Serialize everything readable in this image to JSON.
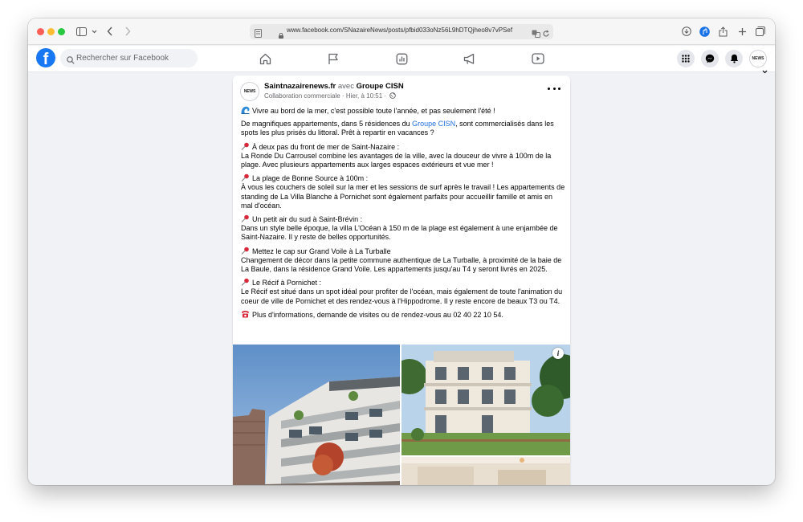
{
  "browser": {
    "url": "www.facebook.com/SNazaireNews/posts/pfbid033oNz56L9hDTQjheo8v7vPSef"
  },
  "facebook": {
    "logo_letter": "f",
    "search_placeholder": "Rechercher sur Facebook",
    "nav": [
      "home-icon",
      "flag-icon",
      "gaming-icon",
      "megaphone-icon",
      "video-icon"
    ],
    "brand_color": "#1877f2"
  },
  "post": {
    "avatar_text": "NEWS",
    "author": "Saintnazairenews.fr",
    "with_word": "avec",
    "partner": "Groupe CISN",
    "subtitle": "Collaboration commerciale · Hier, à 10:51 ·",
    "intro": "Vivre au bord de la mer, c'est possible toute l'année, et pas seulement l'été !",
    "desc_before": "De magnifiques appartements, dans 5 résidences du ",
    "desc_link": "Groupe CISN",
    "desc_after": ", sont commercialisés dans les spots les plus prisés du littoral. Prêt à repartir en vacances ?",
    "sections": [
      {
        "title": "À deux pas du front de mer de Saint-Nazaire :",
        "text": "La Ronde Du Carrousel combine les avantages de la ville, avec la douceur de vivre à 100m de la plage. Avec plusieurs appartements aux larges espaces extérieurs et vue mer !"
      },
      {
        "title": "La plage de Bonne Source à 100m :",
        "text": "À vous les couchers de soleil sur la mer et les sessions de surf après le travail ! Les appartements de standing de La Villa Blanche à Pornichet sont également parfaits pour accueillir famille et amis en mal d'océan."
      },
      {
        "title": "Un petit air du sud à Saint-Brévin :",
        "text": "Dans un style belle époque, la villa L'Océan à 150 m de la plage est également à une enjambée de Saint-Nazaire. Il y reste de belles opportunités."
      },
      {
        "title": "Mettez le cap sur Grand Voile à La Turballe",
        "text": "Changement de décor dans la petite commune authentique de La Turballe, à proximité de la baie de La Baule, dans la résidence Grand Voile. Les appartements jusqu'au T4 y seront livrés en 2025."
      },
      {
        "title": "Le Récif à Pornichet :",
        "text": "Le Récif est situé dans un spot idéal pour profiter de l'océan, mais également de toute l'animation du coeur de ville de Pornichet et des rendez-vous à l'Hippodrome. Il y reste encore de beaux T3 ou T4."
      }
    ],
    "contact": "Plus d'informations, demande de visites ou de rendez-vous au 02 40 22 10 54.",
    "info_glyph": "i"
  }
}
